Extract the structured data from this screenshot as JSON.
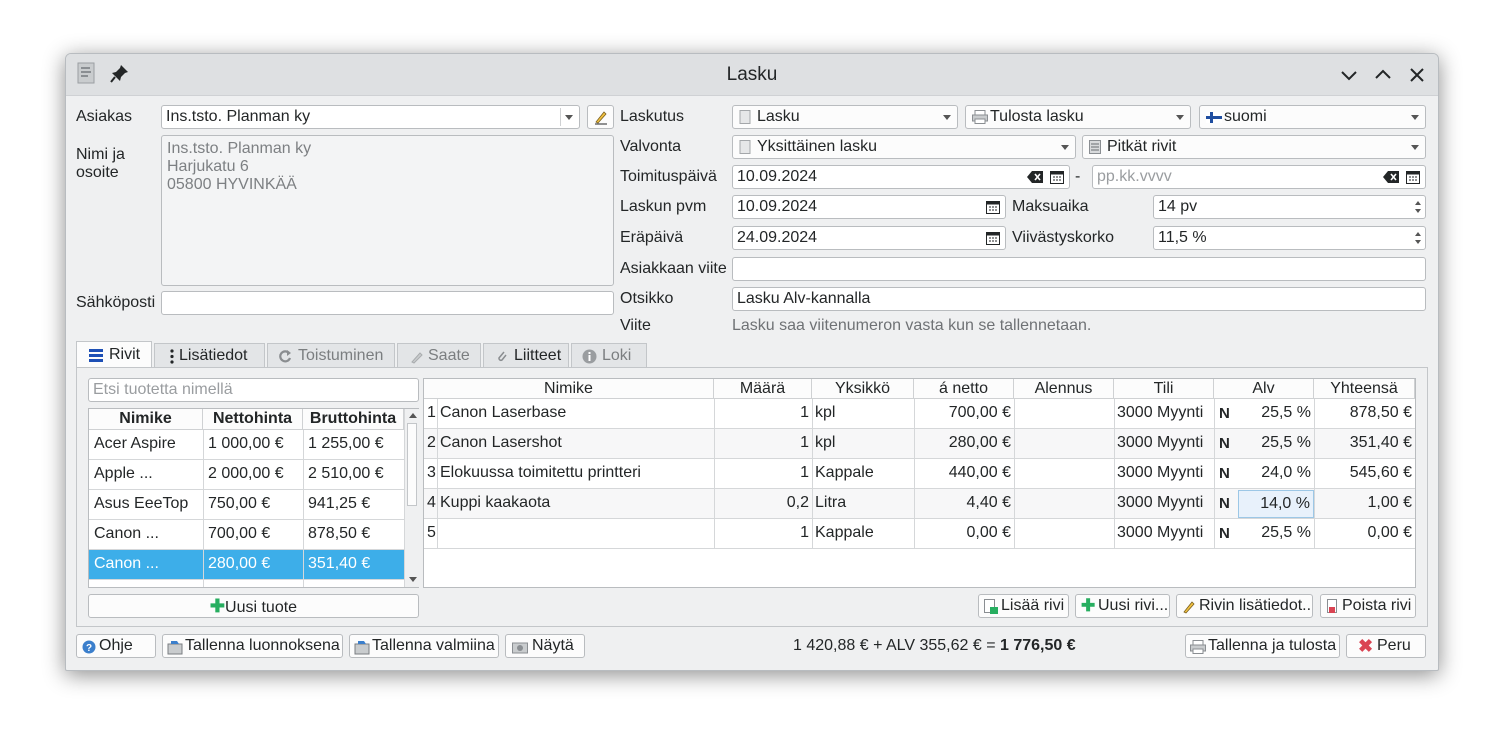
{
  "window": {
    "title": "Lasku"
  },
  "customer": {
    "label": "Asiakas",
    "value": "Ins.tsto. Planman ky",
    "address_label_1": "Nimi ja",
    "address_label_2": "osoite",
    "address_lines": [
      "Ins.tsto. Planman ky",
      "Harjukatu 6",
      "05800 HYVINKÄÄ"
    ],
    "email_label": "Sähköposti",
    "email_value": ""
  },
  "billing": {
    "laskutus_label": "Laskutus",
    "type": "Lasku",
    "print_mode": "Tulosta lasku",
    "language": "suomi",
    "valvonta_label": "Valvonta",
    "valvonta": "Yksittäinen lasku",
    "rows_mode": "Pitkät rivit",
    "delivery_label": "Toimituspäivä",
    "delivery_date": "10.09.2024",
    "delivery_date_end_placeholder": "pp.kk.vvvv",
    "invoice_date_label": "Laskun pvm",
    "invoice_date": "10.09.2024",
    "payment_term_label": "Maksuaika",
    "payment_term": "14 pv",
    "due_date_label": "Eräpäivä",
    "due_date": "24.09.2024",
    "interest_label": "Viivästyskorko",
    "interest": "11,5 %",
    "customer_ref_label": "Asiakkaan viite",
    "customer_ref": "",
    "subject_label": "Otsikko",
    "subject": "Lasku Alv-kannalla",
    "reference_label": "Viite",
    "reference_note": "Lasku saa viitenumeron vasta kun se tallennetaan."
  },
  "tabs": [
    {
      "label": "Rivit",
      "active": true
    },
    {
      "label": "Lisätiedot"
    },
    {
      "label": "Toistuminen"
    },
    {
      "label": "Saate"
    },
    {
      "label": "Liitteet"
    },
    {
      "label": "Loki"
    }
  ],
  "products": {
    "search_placeholder": "Etsi tuotetta nimellä",
    "headers": [
      "Nimike",
      "Nettohinta",
      "Bruttohinta"
    ],
    "rows": [
      [
        "Acer Aspire",
        "1 000,00 €",
        "1 255,00 €"
      ],
      [
        "Apple ...",
        "2 000,00 €",
        "2 510,00 €"
      ],
      [
        "Asus EeeTop",
        "750,00 €",
        "941,25 €"
      ],
      [
        "Canon ...",
        "700,00 €",
        "878,50 €"
      ],
      [
        "Canon ...",
        "280,00 €",
        "351,40 €"
      ]
    ],
    "selected_index": 4,
    "new_product_button": "Uusi tuote"
  },
  "lines": {
    "headers": [
      "Nimike",
      "Määrä",
      "Yksikkö",
      "á netto",
      "Alennus",
      "Tili",
      "Alv",
      "Yhteensä"
    ],
    "rows": [
      {
        "n": "1",
        "name": "Canon Laserbase",
        "qty": "1",
        "unit": "kpl",
        "net": "700,00 €",
        "discount": "",
        "account": "3000 Myynti",
        "vatcode": "N",
        "vat": "25,5 %",
        "total": "878,50 €"
      },
      {
        "n": "2",
        "name": "Canon Lasershot",
        "qty": "1",
        "unit": "kpl",
        "net": "280,00 €",
        "discount": "",
        "account": "3000 Myynti",
        "vatcode": "N",
        "vat": "25,5 %",
        "total": "351,40 €"
      },
      {
        "n": "3",
        "name": "Elokuussa toimitettu printteri",
        "qty": "1",
        "unit": "Kappale",
        "net": "440,00 €",
        "discount": "",
        "account": "3000 Myynti",
        "vatcode": "N",
        "vat": "24,0 %",
        "total": "545,60 €"
      },
      {
        "n": "4",
        "name": "Kuppi kaakaota",
        "qty": "0,2",
        "unit": "Litra",
        "net": "4,40 €",
        "discount": "",
        "account": "3000 Myynti",
        "vatcode": "N",
        "vat": "14,0 %",
        "total": "1,00 €"
      },
      {
        "n": "5",
        "name": "",
        "qty": "1",
        "unit": "Kappale",
        "net": "0,00 €",
        "discount": "",
        "account": "3000 Myynti",
        "vatcode": "N",
        "vat": "25,5 %",
        "total": "0,00 €"
      }
    ],
    "add_row_button": "Lisää rivi",
    "new_row_button": "Uusi rivi...",
    "row_details_button": "Rivin lisätiedot..",
    "delete_row_button": "Poista rivi"
  },
  "footer": {
    "help": "Ohje",
    "save_draft": "Tallenna luonnoksena",
    "save_ready": "Tallenna valmiina",
    "show": "Näytä",
    "totals_prefix": "1 420,88 € + ALV 355,62 € = ",
    "totals_bold": "1 776,50 €",
    "save_print": "Tallenna ja tulosta",
    "cancel": "Peru"
  },
  "colors": {
    "selection": "#3daee9",
    "window_bg": "#eff0f1",
    "titlebar": "#dee0e2",
    "cancel_icon": "#da4453",
    "add_icon": "#27ae60"
  }
}
